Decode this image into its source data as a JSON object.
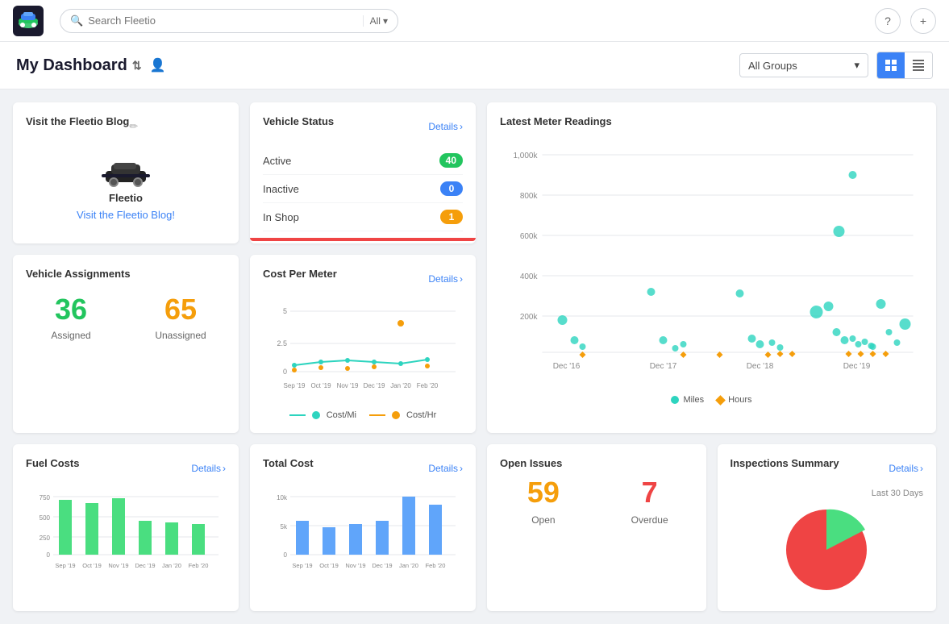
{
  "nav": {
    "search_placeholder": "Search Fleetio",
    "search_filter": "All",
    "help_icon": "?",
    "add_icon": "+"
  },
  "header": {
    "title": "My Dashboard",
    "groups_label": "All Groups",
    "view_grid": "grid",
    "view_expand": "expand"
  },
  "blog": {
    "title": "Visit the Fleetio Blog",
    "logo_text": "Fleetio",
    "link_text": "Visit the Fleetio Blog!",
    "edit_icon": "✏"
  },
  "vehicle_status": {
    "title": "Vehicle Status",
    "details_label": "Details",
    "active_label": "Active",
    "active_count": "40",
    "inactive_label": "Inactive",
    "inactive_count": "0",
    "in_shop_label": "In Shop",
    "in_shop_count": "1"
  },
  "meter_readings": {
    "title": "Latest Meter Readings",
    "legend_miles": "Miles",
    "legend_hours": "Hours",
    "y_labels": [
      "1,000k",
      "800k",
      "600k",
      "400k",
      "200k",
      "0"
    ],
    "x_labels": [
      "Dec '16",
      "Dec '17",
      "Dec '18",
      "Dec '19"
    ]
  },
  "assignments": {
    "title": "Vehicle Assignments",
    "assigned_count": "36",
    "assigned_label": "Assigned",
    "unassigned_count": "65",
    "unassigned_label": "Unassigned"
  },
  "cost_per_meter": {
    "title": "Cost Per Meter",
    "details_label": "Details",
    "legend_cost_mi": "Cost/Mi",
    "legend_cost_hr": "Cost/Hr",
    "y_labels": [
      "5",
      "2.5",
      "0"
    ],
    "x_labels": [
      "Sep '19",
      "Oct '19",
      "Nov '19",
      "Dec '19",
      "Jan '20",
      "Feb '20"
    ]
  },
  "fuel_costs": {
    "title": "Fuel Costs",
    "details_label": "Details",
    "y_labels": [
      "750",
      "500",
      "250",
      "0"
    ],
    "x_labels": [
      "Sep '19",
      "Oct '19",
      "Nov '19",
      "Dec '19",
      "Jan '20",
      "Feb '20"
    ],
    "color": "#4ade80"
  },
  "total_cost": {
    "title": "Total Cost",
    "details_label": "Details",
    "y_labels": [
      "10k",
      "5k",
      "0"
    ],
    "x_labels": [
      "Sep '19",
      "Oct '19",
      "Nov '19",
      "Dec '19",
      "Jan '20",
      "Feb '20"
    ],
    "color": "#60a5fa"
  },
  "open_issues": {
    "title": "Open Issues",
    "open_count": "59",
    "open_label": "Open",
    "overdue_count": "7",
    "overdue_label": "Overdue"
  },
  "inspections": {
    "title": "Inspections Summary",
    "details_label": "Details",
    "period_label": "Last 30 Days",
    "pass_color": "#4ade80",
    "fail_color": "#ef4444"
  }
}
